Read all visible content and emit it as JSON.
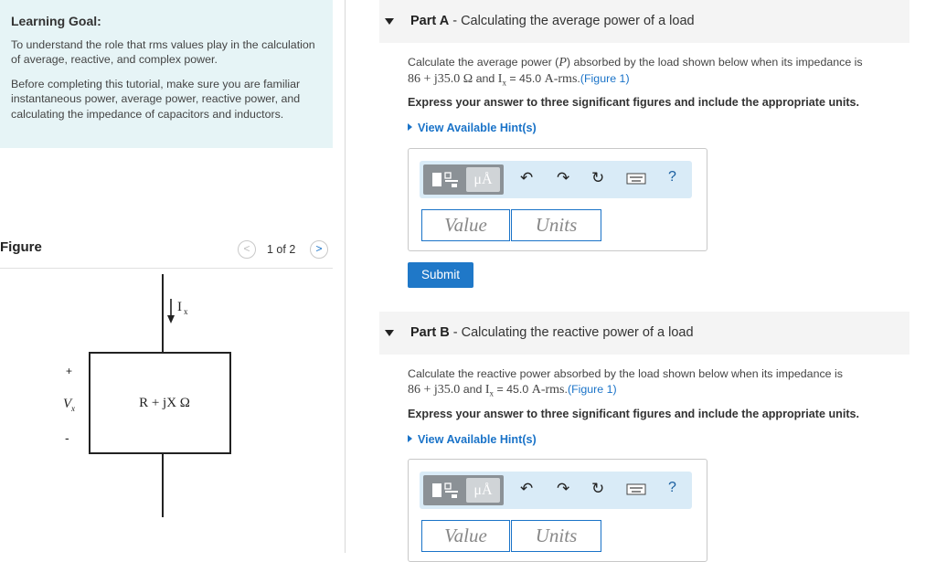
{
  "goal": {
    "title": "Learning Goal:",
    "p1": "To understand the role that rms values play in the calculation of average, reactive, and complex power.",
    "p2": "Before completing this tutorial, make sure you are familiar instantaneous power, average power, reactive power, and calculating the impedance of capacitors and inductors."
  },
  "figure": {
    "label": "Figure",
    "counter": "1 of 2",
    "prev": "<",
    "next": ">",
    "current_label": "I",
    "current_sub": "x",
    "voltage_label": "V",
    "voltage_sub": "x",
    "plus": "+",
    "minus": "-",
    "impedance": "R + jX Ω"
  },
  "partA": {
    "letter": "Part A",
    "title": "Calculating the average power of a load",
    "q_line1_pre": "Calculate the average power (",
    "q_var": "P",
    "q_line1_post": ") absorbed by the load shown below when its impedance is",
    "q_line2_imp": "86 + j35.0 Ω",
    "q_line2_and": " and ",
    "q_line2_I": "I",
    "q_line2_Isub": "x",
    "q_line2_val": " = 45.0 ",
    "q_line2_unit": "A-rms",
    "q_line2_dot": ".",
    "figure_link": "(Figure 1)",
    "instruction": "Express your answer to three significant figures and include the appropriate units.",
    "hint": "View Available Hint(s)",
    "value_placeholder": "Value",
    "units_placeholder": "Units",
    "submit": "Submit"
  },
  "partB": {
    "letter": "Part B",
    "title": "Calculating the reactive power of a load",
    "q_line1": "Calculate the reactive power absorbed by the load shown below when its impedance is",
    "q_line2_imp": "86 + j35.0",
    "q_line2_and": " and ",
    "q_line2_I": "I",
    "q_line2_Isub": "x",
    "q_line2_val": " = 45.0 ",
    "q_line2_unit": "A-rms",
    "q_line2_dot": ".",
    "figure_link": "(Figure 1)",
    "instruction": "Express your answer to three significant figures and include the appropriate units.",
    "hint": "View Available Hint(s)",
    "value_placeholder": "Value",
    "units_placeholder": "Units"
  },
  "toolbar": {
    "mu_label": "μÅ",
    "undo_icon": "undo-icon",
    "redo_icon": "redo-icon",
    "reset_icon": "reset-icon",
    "keyboard_icon": "keyboard-icon",
    "help": "?"
  },
  "colors": {
    "goal_bg": "#e6f4f6",
    "accent": "#1a73c8",
    "header_bg": "#f4f4f4",
    "toolbar_bg": "#d9ebf7"
  }
}
